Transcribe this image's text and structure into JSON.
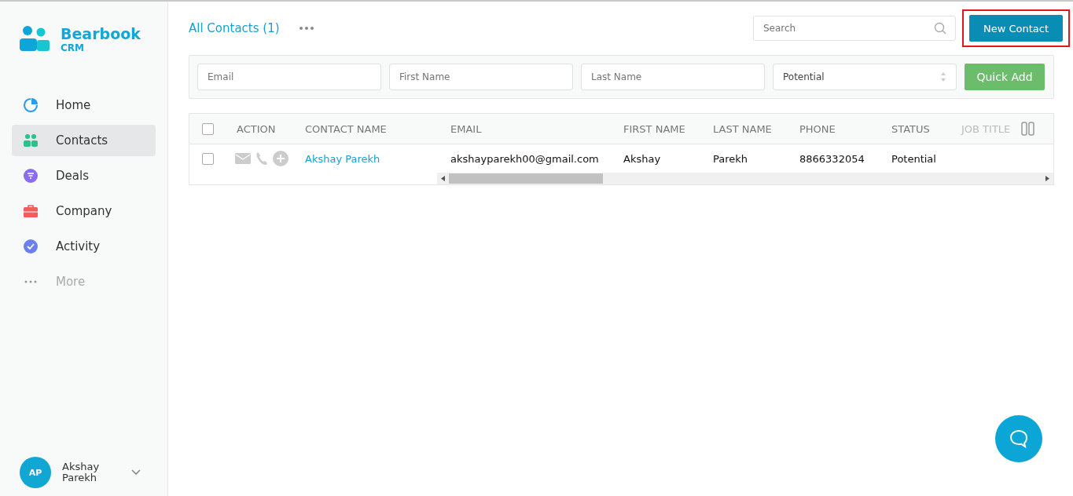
{
  "brand": {
    "name": "Bearbook",
    "sub": "CRM"
  },
  "nav": [
    {
      "label": "Home",
      "kind": "home",
      "selected": false
    },
    {
      "label": "Contacts",
      "kind": "contacts",
      "selected": true
    },
    {
      "label": "Deals",
      "kind": "deals",
      "selected": false
    },
    {
      "label": "Company",
      "kind": "company",
      "selected": false
    },
    {
      "label": "Activity",
      "kind": "activity",
      "selected": false
    },
    {
      "label": "More",
      "kind": "more",
      "selected": false
    }
  ],
  "user": {
    "initials": "AP",
    "first": "Akshay",
    "last": "Parekh"
  },
  "header": {
    "title": "All Contacts (1)",
    "search_placeholder": "Search",
    "new_button": "New Contact",
    "new_button_highlighted": true
  },
  "quick_add": {
    "fields": [
      {
        "placeholder": "Email"
      },
      {
        "placeholder": "First Name"
      },
      {
        "placeholder": "Last Name"
      }
    ],
    "status": "Potential",
    "button": "Quick Add"
  },
  "table": {
    "columns": [
      "ACTION",
      "CONTACT NAME",
      "EMAIL",
      "FIRST NAME",
      "LAST NAME",
      "PHONE",
      "STATUS",
      "JOB TITLE"
    ],
    "all_checked": false,
    "rows": [
      {
        "checked": false,
        "name": "Akshay Parekh",
        "email": "akshayparekh00@gmail.com",
        "first": "Akshay",
        "last": "Parekh",
        "phone": "8866332054",
        "status": "Potential"
      }
    ]
  }
}
